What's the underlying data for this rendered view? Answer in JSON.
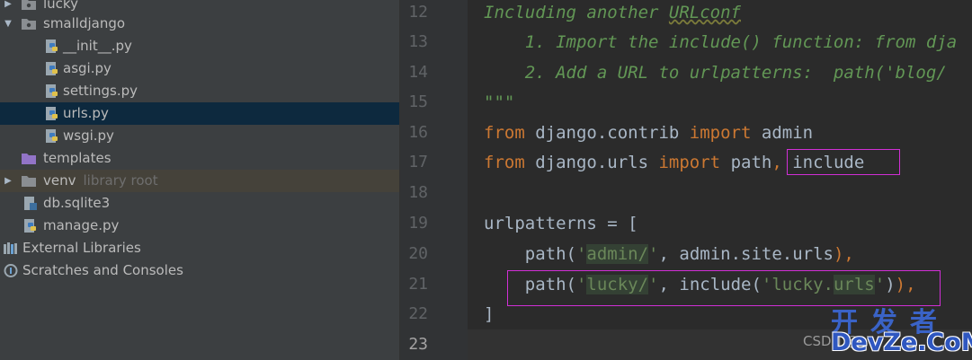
{
  "project_tree": {
    "items": [
      {
        "label": "lucky"
      },
      {
        "label": "smalldjango"
      },
      {
        "label": "__init__.py"
      },
      {
        "label": "asgi.py"
      },
      {
        "label": "settings.py"
      },
      {
        "label": "urls.py"
      },
      {
        "label": "wsgi.py"
      },
      {
        "label": "templates"
      },
      {
        "label": "venv",
        "secondary": "library root"
      },
      {
        "label": "db.sqlite3"
      },
      {
        "label": "manage.py"
      },
      {
        "label": "External Libraries"
      },
      {
        "label": "Scratches and Consoles"
      }
    ],
    "selected": "urls.py"
  },
  "editor": {
    "line_numbers": [
      "12",
      "13",
      "14",
      "15",
      "16",
      "17",
      "18",
      "19",
      "20",
      "21",
      "22",
      "23"
    ],
    "current_line": "23",
    "lines": {
      "l12": {
        "a": "Including another ",
        "b": "URLconf"
      },
      "l13": "    1. Import the include() function: from dja",
      "l14": "    2. Add a URL to urlpatterns:  path('blog/",
      "l15": "\"\"\"",
      "l16": {
        "kw1": "from",
        "mod": " django.contrib ",
        "kw2": "import",
        "name": " admin"
      },
      "l17": {
        "kw1": "from",
        "mod": " django.urls ",
        "kw2": "import",
        "name": " path",
        "comma": ",",
        "name2": " include"
      },
      "l19": "urlpatterns = [",
      "l20": {
        "pre": "    path(",
        "q1": "'",
        "s": "admin/",
        "q2": "'",
        "rest": ", admin.site.urls",
        "end": "),"
      },
      "l21": {
        "pre": "    path(",
        "q1": "'",
        "s": "lucky/",
        "q2": "'",
        "mid": ", include(",
        "q3": "'",
        "s2": "lucky.",
        "s3": "urls",
        "q4": "'",
        "rest": ")",
        "end": "),"
      },
      "l22": "]"
    }
  },
  "watermark": {
    "csdn": "CSDN @",
    "cn": "开发者",
    "en": "DevZe.CoM"
  },
  "colors": {
    "comment": "#629755",
    "keyword": "#cc7832",
    "string": "#6a8759",
    "text": "#a9b7c6",
    "highlight_box": "#d12fd6"
  }
}
